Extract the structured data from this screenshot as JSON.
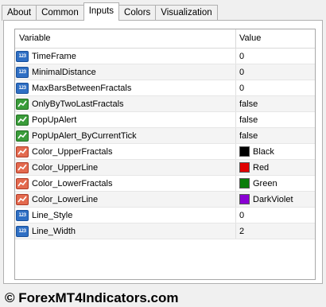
{
  "tabs": [
    {
      "label": "About",
      "active": false
    },
    {
      "label": "Common",
      "active": false
    },
    {
      "label": "Inputs",
      "active": true
    },
    {
      "label": "Colors",
      "active": false
    },
    {
      "label": "Visualization",
      "active": false
    }
  ],
  "table": {
    "headers": {
      "variable": "Variable",
      "value": "Value"
    },
    "rows": [
      {
        "icon": "numeric-icon",
        "variable": "TimeFrame",
        "value": "0"
      },
      {
        "icon": "numeric-icon",
        "variable": "MinimalDistance",
        "value": "0"
      },
      {
        "icon": "numeric-icon",
        "variable": "MaxBarsBetweenFractals",
        "value": "0"
      },
      {
        "icon": "boolean-icon",
        "variable": "OnlyByTwoLastFractals",
        "value": "false"
      },
      {
        "icon": "boolean-icon",
        "variable": "PopUpAlert",
        "value": "false"
      },
      {
        "icon": "boolean-icon",
        "variable": "PopUpAlert_ByCurrentTick",
        "value": "false"
      },
      {
        "icon": "color-icon",
        "variable": "Color_UpperFractals",
        "value": "Black",
        "swatch": "#000000"
      },
      {
        "icon": "color-icon",
        "variable": "Color_UpperLine",
        "value": "Red",
        "swatch": "#e00000"
      },
      {
        "icon": "color-icon",
        "variable": "Color_LowerFractals",
        "value": "Green",
        "swatch": "#0a7d0a"
      },
      {
        "icon": "color-icon",
        "variable": "Color_LowerLine",
        "value": "DarkViolet",
        "swatch": "#8a00d4"
      },
      {
        "icon": "numeric-icon",
        "variable": "Line_Style",
        "value": "0"
      },
      {
        "icon": "numeric-icon",
        "variable": "Line_Width",
        "value": "2"
      }
    ]
  },
  "watermark": "© ForexMT4Indicators.com"
}
